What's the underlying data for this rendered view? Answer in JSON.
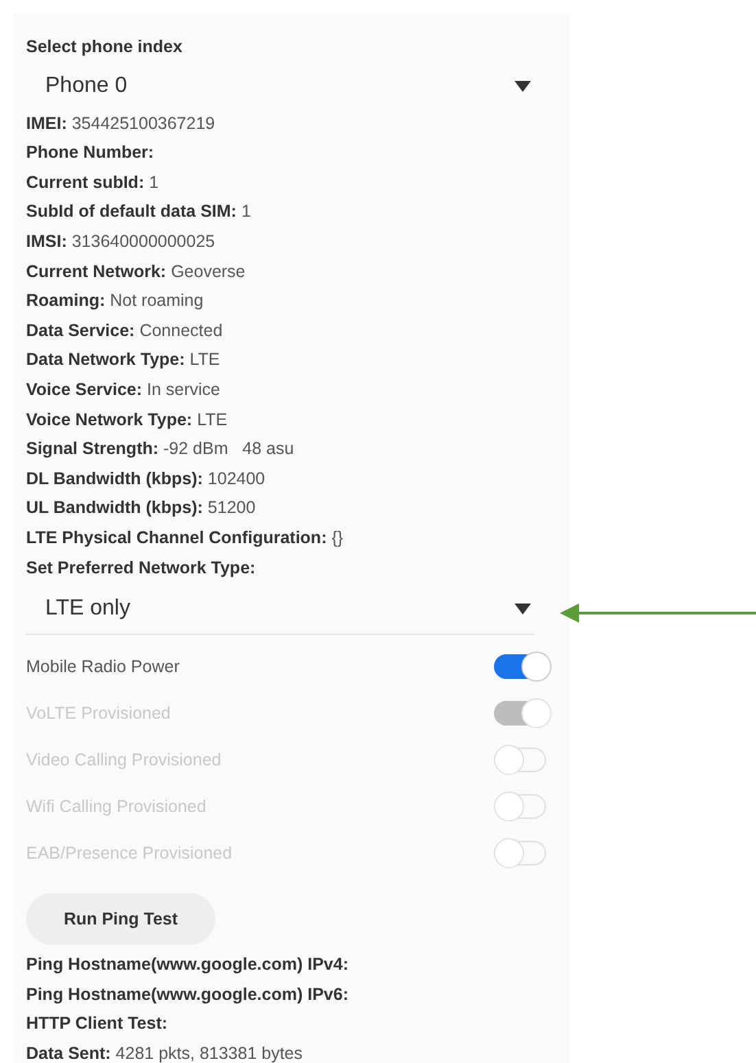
{
  "phone_select": {
    "label": "Select phone index",
    "value": "Phone 0"
  },
  "info_lines": [
    {
      "text": "**IMEI:** 354425100367219"
    },
    {
      "text": "**Phone Number:**"
    },
    {
      "text": "**Current subId:** 1"
    },
    {
      "text": "**SubId of default data SIM:** 1"
    },
    {
      "text": "**IMSI:** 313640000000025"
    },
    {
      "text": "**Current Network:** Geoverse"
    },
    {
      "text": "**Roaming:** Not roaming"
    },
    {
      "text": "**Data Service:** Connected"
    },
    {
      "text": "**Data Network Type:** LTE"
    },
    {
      "text": "**Voice Service:** In service"
    },
    {
      "text": "**Voice Network Type:** LTE"
    },
    {
      "text": "**Signal Strength:** -92 dBm   48 asu"
    },
    {
      "text": "**DL Bandwidth (kbps):** 102400"
    },
    {
      "text": "**UL Bandwidth (kbps):** 51200"
    },
    {
      "text": "**LTE Physical Channel Configuration:** {}"
    }
  ],
  "network_select": {
    "label": "Set Preferred Network Type:",
    "value": "LTE only"
  },
  "toggles": [
    {
      "label": "Mobile Radio Power",
      "on": true,
      "disabled": false
    },
    {
      "label": "VoLTE Provisioned",
      "on": true,
      "disabled": true
    },
    {
      "label": "Video Calling Provisioned",
      "on": false,
      "disabled": true
    },
    {
      "label": "Wifi Calling Provisioned",
      "on": false,
      "disabled": true
    },
    {
      "label": "EAB/Presence Provisioned",
      "on": false,
      "disabled": true
    }
  ],
  "ping_button": "Run Ping Test",
  "result_lines": [
    {
      "text": "**Ping Hostname(www.google.com) IPv4:**"
    },
    {
      "text": "**Ping Hostname(www.google.com) IPv6:**"
    },
    {
      "text": "**HTTP Client Test:**"
    },
    {
      "text": "**Data Sent:** 4281 pkts, 813381 bytes"
    }
  ]
}
